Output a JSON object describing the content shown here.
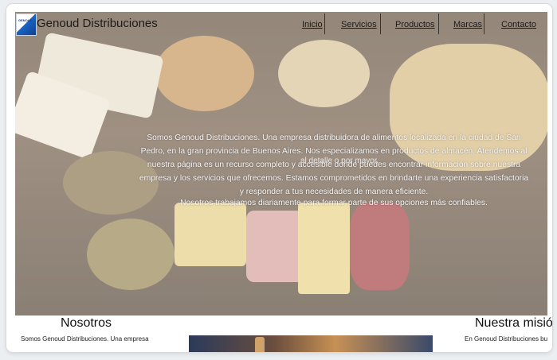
{
  "brand": {
    "logo_text": "GENOUD",
    "name": "Genoud Distribuciones"
  },
  "nav": {
    "items": [
      "Inicio",
      "Servicios",
      "Productos",
      "Marcas",
      "Contacto"
    ]
  },
  "hero": {
    "paragraph_1": "Somos Genoud Distribuciones. Una empresa distribuidora de alimentos localizada en la ciudad de San Pedro, en la gran provincia de Buenos Aires. Nos especializamos en productos de almacén. Atendemos al nuestra página es un recurso completo y accesible donde puedes encontrar información sobre nuestra empresa y los servicios que ofrecemos. Estamos comprometidos en brindarte una experiencia satisfactoria y responder a tus necesidades de manera eficiente.",
    "paragraph_2": "Nosotros trabajamos diariamente para formar parte de sus opciones más confiables.",
    "overlap_text": "al detalle o por mayor."
  },
  "sections": {
    "nosotros": {
      "title": "Nosotros",
      "text": "Somos Genoud Distribuciones. Una empresa"
    },
    "mision": {
      "title": "Nuestra misión",
      "text": "En Genoud Distribuciones bu"
    }
  },
  "colors": {
    "accent": "#1a64c8",
    "background": "#eceff2"
  }
}
